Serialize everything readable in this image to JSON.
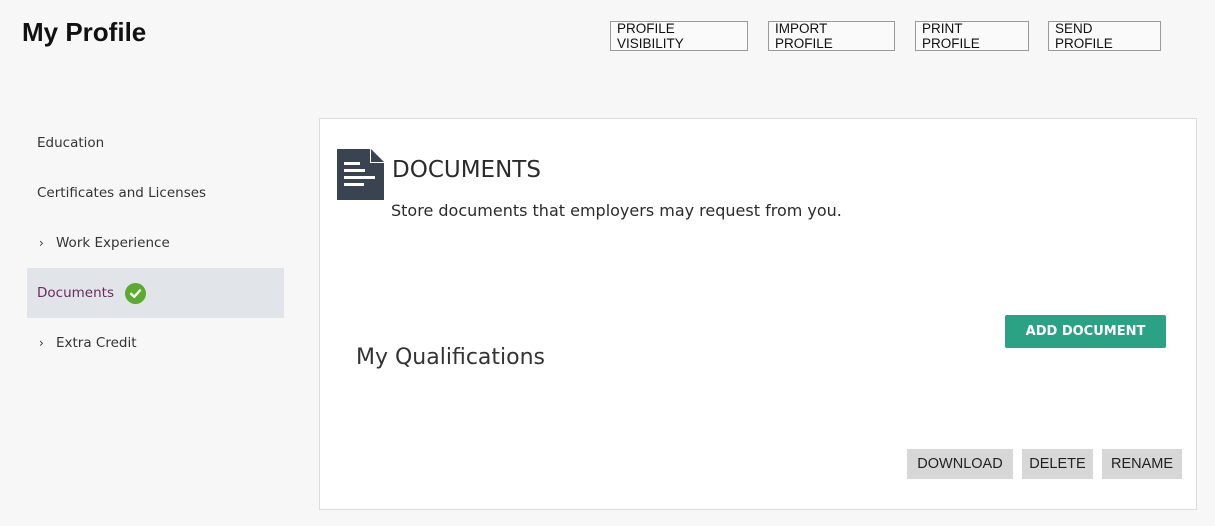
{
  "page": {
    "title": "My Profile"
  },
  "toolbar": {
    "profile_visibility": "PROFILE VISIBILITY",
    "import_profile": "IMPORT PROFILE",
    "print_profile": "PRINT PROFILE",
    "send_profile": "SEND PROFILE"
  },
  "sidebar": {
    "items": [
      {
        "label": "Education",
        "expandable": false,
        "active": false
      },
      {
        "label": "Certificates and Licenses",
        "expandable": false,
        "active": false
      },
      {
        "label": "Work Experience",
        "expandable": true,
        "active": false,
        "icon": "chevron-right-icon"
      },
      {
        "label": "Documents",
        "expandable": false,
        "active": true,
        "icon": "check-circle-icon"
      },
      {
        "label": "Extra Credit",
        "expandable": true,
        "active": false,
        "icon": "chevron-right-icon"
      }
    ]
  },
  "documents": {
    "icon": "document-icon",
    "heading": "DOCUMENTS",
    "description": "Store documents that employers may request from you.",
    "add_button": "ADD DOCUMENT",
    "qualifications_heading": "My Qualifications",
    "actions": {
      "download": "DOWNLOAD",
      "delete": "DELETE",
      "rename": "RENAME"
    }
  },
  "colors": {
    "accent_green": "#2aa283",
    "check_green": "#5aab2e",
    "active_item_text": "#6b2a5e",
    "active_item_bg": "#e1e4e8",
    "icon_dark": "#3a4350"
  }
}
